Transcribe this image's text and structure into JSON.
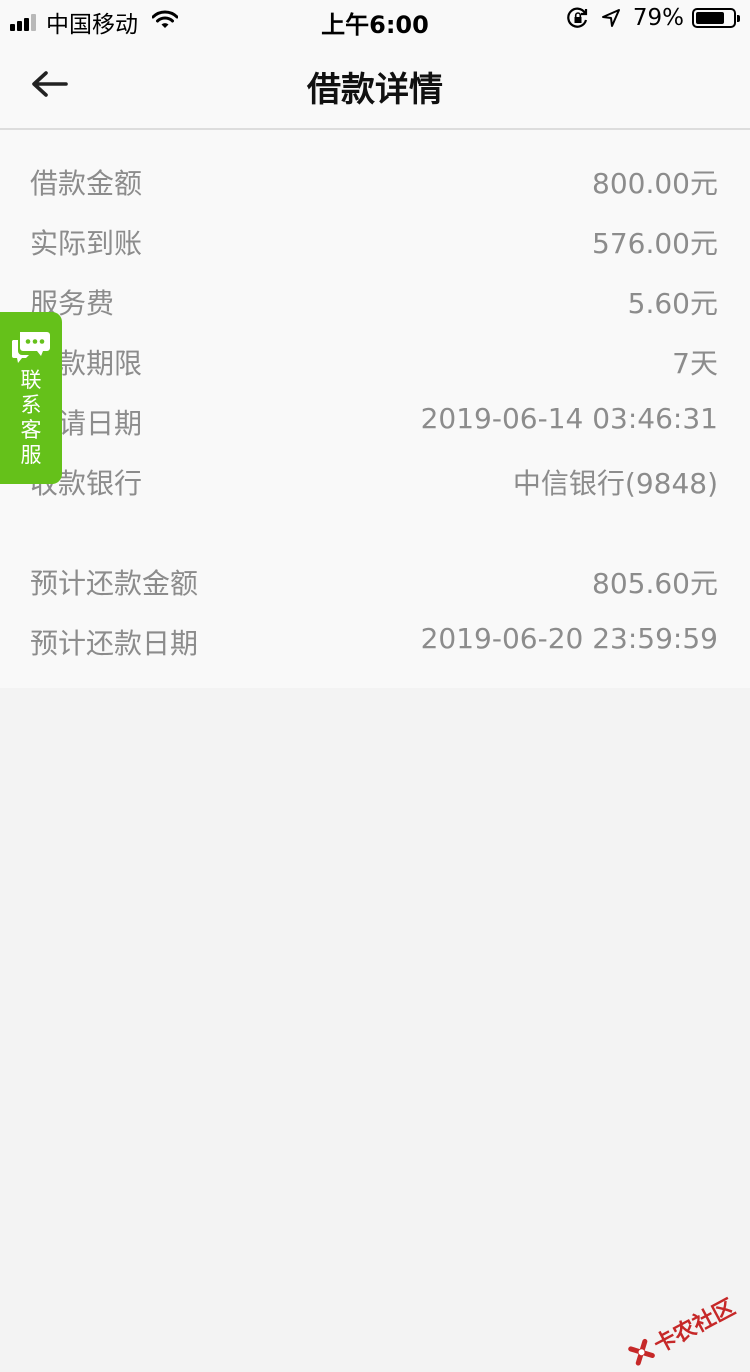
{
  "status_bar": {
    "carrier": "中国移动",
    "time": "上午6:00",
    "battery_percent": "79%",
    "battery_level": 0.79
  },
  "nav": {
    "title": "借款详情"
  },
  "details": {
    "rows": [
      {
        "label": "借款金额",
        "value": "800.00元"
      },
      {
        "label": "实际到账",
        "value": "576.00元"
      },
      {
        "label": "服务费",
        "value": "5.60元"
      },
      {
        "label": "借款期限",
        "value": "7天"
      },
      {
        "label": "申请日期",
        "value": "2019-06-14 03:46:31"
      },
      {
        "label": "收款银行",
        "value": "中信银行(9848)"
      },
      {
        "label": "预计还款金额",
        "value": "805.60元"
      },
      {
        "label": "预计还款日期",
        "value": "2019-06-20 23:59:59"
      }
    ]
  },
  "service_tab": {
    "chars": [
      "联",
      "系",
      "客",
      "服"
    ],
    "color": "#65c11a"
  },
  "watermark": {
    "text": "卡农社区"
  }
}
